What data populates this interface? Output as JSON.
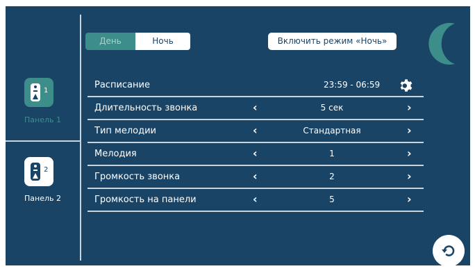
{
  "sidebar": {
    "panels": [
      {
        "label": "Панель 1",
        "number": "1",
        "active": true
      },
      {
        "label": "Панель 2",
        "number": "2",
        "active": false
      }
    ]
  },
  "header": {
    "toggle": {
      "day_label": "День",
      "night_label": "Ночь",
      "selected": "Ночь"
    },
    "mode_button_label": "Включить режим «Ночь»",
    "mode_icon": "moon-icon"
  },
  "settings": {
    "schedule": {
      "label": "Расписание",
      "value": "23:59 - 06:59",
      "icon": "gear-icon"
    },
    "rows": [
      {
        "label": "Длительность звонка",
        "value": "5 сек"
      },
      {
        "label": "Тип мелодии",
        "value": "Стандартная"
      },
      {
        "label": "Мелодия",
        "value": "1"
      },
      {
        "label": "Громкость звонка",
        "value": "2"
      },
      {
        "label": "Громкость на панели",
        "value": "5"
      }
    ]
  },
  "footer": {
    "back_icon": "back-arrow-icon"
  },
  "colors": {
    "background": "#1a4466",
    "accent": "#3d8e8a",
    "divider": "#c9d3dc",
    "text": "#ffffff"
  }
}
